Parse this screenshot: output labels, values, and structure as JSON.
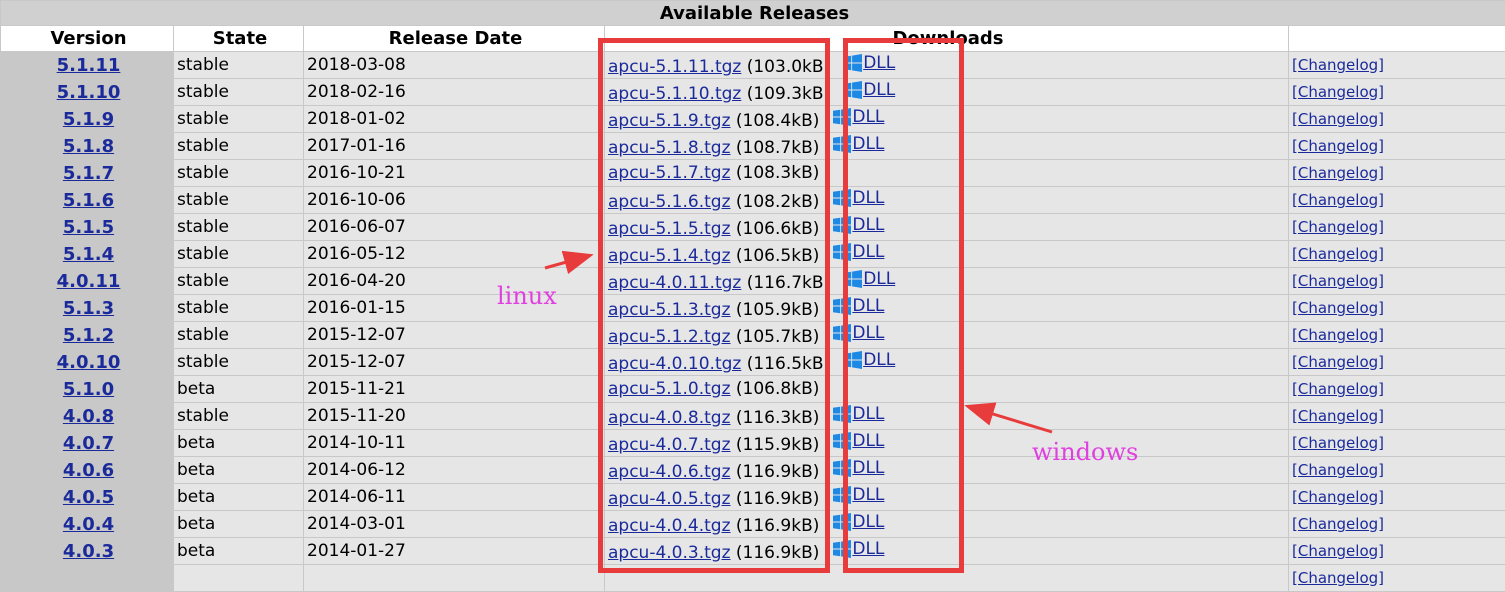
{
  "table": {
    "caption": "Available Releases",
    "headers": {
      "version": "Version",
      "state": "State",
      "release_date": "Release Date",
      "downloads": "Downloads",
      "extra": ""
    },
    "rows": [
      {
        "version": "5.1.11",
        "state": "stable",
        "date": "2018-03-08",
        "tgz": "apcu-5.1.11.tgz",
        "size": "(103.0kB)",
        "dll": "DLL",
        "changelog": "[Changelog]"
      },
      {
        "version": "5.1.10",
        "state": "stable",
        "date": "2018-02-16",
        "tgz": "apcu-5.1.10.tgz",
        "size": "(109.3kB)",
        "dll": "DLL",
        "changelog": "[Changelog]"
      },
      {
        "version": "5.1.9",
        "state": "stable",
        "date": "2018-01-02",
        "tgz": "apcu-5.1.9.tgz",
        "size": "(108.4kB)",
        "dll": "DLL",
        "changelog": "[Changelog]"
      },
      {
        "version": "5.1.8",
        "state": "stable",
        "date": "2017-01-16",
        "tgz": "apcu-5.1.8.tgz",
        "size": "(108.7kB)",
        "dll": "DLL",
        "changelog": "[Changelog]"
      },
      {
        "version": "5.1.7",
        "state": "stable",
        "date": "2016-10-21",
        "tgz": "apcu-5.1.7.tgz",
        "size": "(108.3kB)",
        "dll": "",
        "changelog": "[Changelog]"
      },
      {
        "version": "5.1.6",
        "state": "stable",
        "date": "2016-10-06",
        "tgz": "apcu-5.1.6.tgz",
        "size": "(108.2kB)",
        "dll": "DLL",
        "changelog": "[Changelog]"
      },
      {
        "version": "5.1.5",
        "state": "stable",
        "date": "2016-06-07",
        "tgz": "apcu-5.1.5.tgz",
        "size": "(106.6kB)",
        "dll": "DLL",
        "changelog": "[Changelog]"
      },
      {
        "version": "5.1.4",
        "state": "stable",
        "date": "2016-05-12",
        "tgz": "apcu-5.1.4.tgz",
        "size": "(106.5kB)",
        "dll": "DLL",
        "changelog": "[Changelog]"
      },
      {
        "version": "4.0.11",
        "state": "stable",
        "date": "2016-04-20",
        "tgz": "apcu-4.0.11.tgz",
        "size": "(116.7kB)",
        "dll": "DLL",
        "changelog": "[Changelog]"
      },
      {
        "version": "5.1.3",
        "state": "stable",
        "date": "2016-01-15",
        "tgz": "apcu-5.1.3.tgz",
        "size": "(105.9kB)",
        "dll": "DLL",
        "changelog": "[Changelog]"
      },
      {
        "version": "5.1.2",
        "state": "stable",
        "date": "2015-12-07",
        "tgz": "apcu-5.1.2.tgz",
        "size": "(105.7kB)",
        "dll": "DLL",
        "changelog": "[Changelog]"
      },
      {
        "version": "4.0.10",
        "state": "stable",
        "date": "2015-12-07",
        "tgz": "apcu-4.0.10.tgz",
        "size": "(116.5kB)",
        "dll": "DLL",
        "changelog": "[Changelog]"
      },
      {
        "version": "5.1.0",
        "state": "beta",
        "date": "2015-11-21",
        "tgz": "apcu-5.1.0.tgz",
        "size": "(106.8kB)",
        "dll": "",
        "changelog": "[Changelog]"
      },
      {
        "version": "4.0.8",
        "state": "stable",
        "date": "2015-11-20",
        "tgz": "apcu-4.0.8.tgz",
        "size": "(116.3kB)",
        "dll": "DLL",
        "changelog": "[Changelog]"
      },
      {
        "version": "4.0.7",
        "state": "beta",
        "date": "2014-10-11",
        "tgz": "apcu-4.0.7.tgz",
        "size": "(115.9kB)",
        "dll": "DLL",
        "changelog": "[Changelog]"
      },
      {
        "version": "4.0.6",
        "state": "beta",
        "date": "2014-06-12",
        "tgz": "apcu-4.0.6.tgz",
        "size": "(116.9kB)",
        "dll": "DLL",
        "changelog": "[Changelog]"
      },
      {
        "version": "4.0.5",
        "state": "beta",
        "date": "2014-06-11",
        "tgz": "apcu-4.0.5.tgz",
        "size": "(116.9kB)",
        "dll": "DLL",
        "changelog": "[Changelog]"
      },
      {
        "version": "4.0.4",
        "state": "beta",
        "date": "2014-03-01",
        "tgz": "apcu-4.0.4.tgz",
        "size": "(116.9kB)",
        "dll": "DLL",
        "changelog": "[Changelog]"
      },
      {
        "version": "4.0.3",
        "state": "beta",
        "date": "2014-01-27",
        "tgz": "apcu-4.0.3.tgz",
        "size": "(116.9kB)",
        "dll": "DLL",
        "changelog": "[Changelog]"
      },
      {
        "version": "",
        "state": "",
        "date": "",
        "tgz": "",
        "size": "",
        "dll": "",
        "changelog": "[Changelog]"
      }
    ]
  },
  "annotations": {
    "linux_label": "linux",
    "windows_label": "windows",
    "box_color": "#e83b3b",
    "label_color": "#e040e0"
  },
  "colors": {
    "link": "#1a2a9a",
    "row_bg": "#e6e6e6",
    "version_bg": "#c8c8c8",
    "windows_icon": "#1e88e5"
  }
}
